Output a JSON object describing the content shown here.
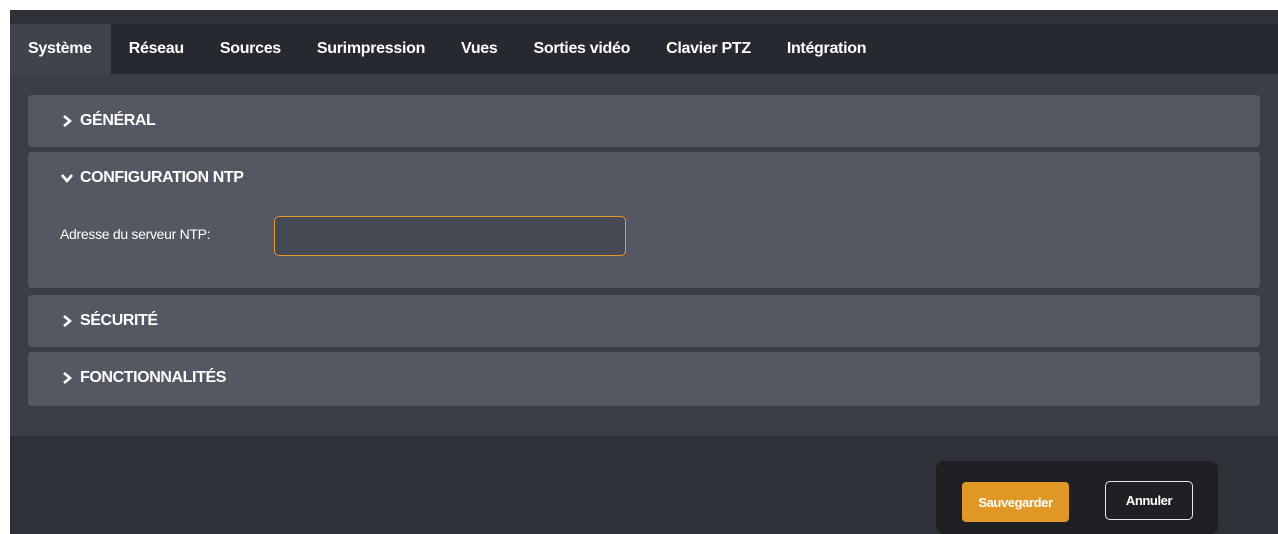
{
  "tabs": [
    {
      "label": "Système",
      "active": true
    },
    {
      "label": "Réseau"
    },
    {
      "label": "Sources"
    },
    {
      "label": "Surimpression"
    },
    {
      "label": "Vues"
    },
    {
      "label": "Sorties vidéo"
    },
    {
      "label": "Clavier PTZ"
    },
    {
      "label": "Intégration"
    }
  ],
  "sections": {
    "general": {
      "title": "GÉNÉRAL",
      "expanded": false,
      "icon": "chevron-right-icon"
    },
    "ntp": {
      "title": "CONFIGURATION NTP",
      "expanded": true,
      "icon": "chevron-down-icon",
      "server_label": "Adresse du serveur NTP:",
      "server_value": ""
    },
    "security": {
      "title": "SÉCURITÉ",
      "expanded": false,
      "icon": "chevron-right-icon"
    },
    "features": {
      "title": "FONCTIONNALITÉS",
      "expanded": false,
      "icon": "chevron-right-icon"
    }
  },
  "actions": {
    "save_label": "Sauvegarder",
    "cancel_label": "Annuler"
  },
  "colors": {
    "accent": "#e19725",
    "background": "#2e3138",
    "panel": "#545862",
    "tabbar": "#262930"
  }
}
